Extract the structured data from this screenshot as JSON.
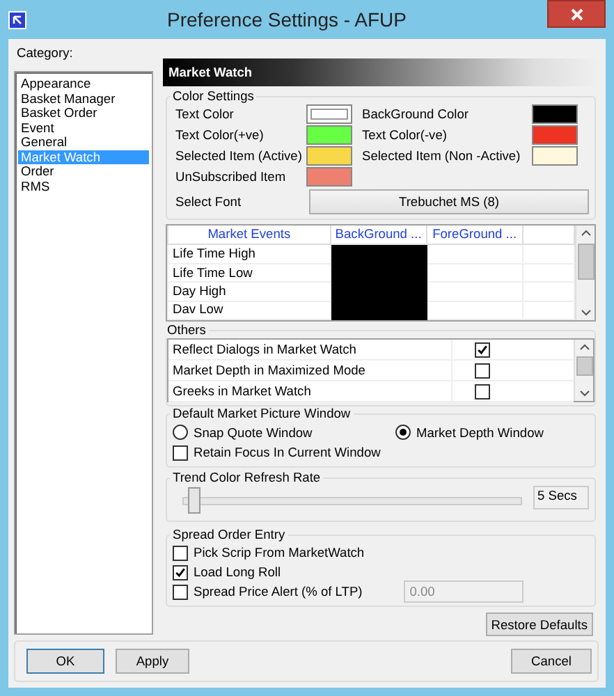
{
  "window": {
    "title": "Preference Settings - AFUP"
  },
  "category_label": "Category:",
  "categories": [
    {
      "label": "Appearance",
      "selected": false
    },
    {
      "label": "Basket Manager",
      "selected": false
    },
    {
      "label": "Basket Order",
      "selected": false
    },
    {
      "label": "Event",
      "selected": false
    },
    {
      "label": "General",
      "selected": false
    },
    {
      "label": "Market Watch",
      "selected": true
    },
    {
      "label": "Order",
      "selected": false
    },
    {
      "label": "RMS",
      "selected": false
    }
  ],
  "panel_header": "Market Watch",
  "color_settings": {
    "title": "Color Settings",
    "items": [
      {
        "label": "Text Color",
        "color": "#ffffff"
      },
      {
        "label": "BackGround Color",
        "color": "#000000"
      },
      {
        "label": "Text Color(+ve)",
        "color": "#66ff44"
      },
      {
        "label": "Text Color(-ve)",
        "color": "#ee3322"
      },
      {
        "label": "Selected Item (Active)",
        "color": "#f8d848"
      },
      {
        "label": "Selected Item (Non -Active)",
        "color": "#fff8dc"
      },
      {
        "label": "UnSubscribed Item",
        "color": "#ee8070"
      }
    ],
    "font_label": "Select Font",
    "font_button": "Trebuchet MS (8)"
  },
  "events_table": {
    "columns": [
      "Market Events",
      "BackGround ...",
      "ForeGround ..."
    ],
    "rows": [
      {
        "name": "Life Time High",
        "color": "#000000"
      },
      {
        "name": "Life Time Low",
        "color": "#000000"
      },
      {
        "name": "Day High",
        "color": "#000000"
      },
      {
        "name": "Dav Low",
        "color": "#000000"
      }
    ]
  },
  "others": {
    "title": "Others",
    "rows": [
      {
        "label": "Reflect Dialogs in Market Watch",
        "checked": true
      },
      {
        "label": "Market Depth in Maximized Mode",
        "checked": false
      },
      {
        "label": "Greeks in Market Watch",
        "checked": false
      }
    ]
  },
  "default_window": {
    "title": "Default Market Picture Window",
    "options": [
      {
        "label": "Snap Quote Window",
        "selected": false
      },
      {
        "label": "Market Depth Window",
        "selected": true
      }
    ],
    "retain_focus": {
      "label": "Retain Focus In Current Window",
      "checked": false
    }
  },
  "trend": {
    "title": "Trend Color Refresh Rate",
    "level": 0.03,
    "reading": "5 Secs"
  },
  "spread": {
    "title": "Spread Order Entry",
    "items": [
      {
        "label": "Pick Scrip From MarketWatch",
        "checked": false
      },
      {
        "label": "Load Long Roll",
        "checked": true
      },
      {
        "label": "Spread Price Alert (% of LTP)",
        "checked": false
      }
    ],
    "alert_value": "0.00"
  },
  "buttons": {
    "restore": "Restore Defaults",
    "ok": "OK",
    "apply": "Apply",
    "cancel": "Cancel"
  }
}
